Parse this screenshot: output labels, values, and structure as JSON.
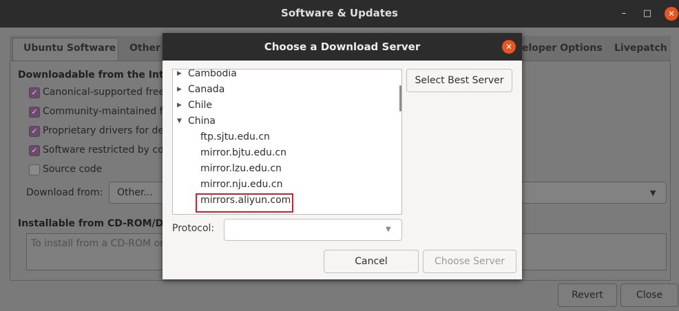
{
  "window": {
    "title": "Software & Updates"
  },
  "tabs": [
    "Ubuntu Software",
    "Other",
    "eloper Options",
    "Livepatch"
  ],
  "main": {
    "downloadable_heading": "Downloadable from the Intern",
    "checkboxes": [
      {
        "label": "Canonical-supported free",
        "checked": true
      },
      {
        "label": "Community-maintained fr",
        "checked": true
      },
      {
        "label": "Proprietary drivers for de",
        "checked": true
      },
      {
        "label": "Software restricted by cop",
        "checked": true
      },
      {
        "label": "Source code",
        "checked": false
      }
    ],
    "download_from_label": "Download from:",
    "download_from_value": "Other...",
    "cdrom_heading": "Installable from CD-ROM/DVD",
    "cdrom_text": "To install from a CD-ROM or D"
  },
  "bottom_buttons": {
    "revert": "Revert",
    "close": "Close"
  },
  "dialog": {
    "title": "Choose a Download Server",
    "tree": [
      {
        "label": "Cambodia",
        "expanded": false
      },
      {
        "label": "Canada",
        "expanded": false
      },
      {
        "label": "Chile",
        "expanded": false
      },
      {
        "label": "China",
        "expanded": true
      },
      {
        "label": "ftp.sjtu.edu.cn",
        "child": true
      },
      {
        "label": "mirror.bjtu.edu.cn",
        "child": true
      },
      {
        "label": "mirror.lzu.edu.cn",
        "child": true
      },
      {
        "label": "mirror.nju.edu.cn",
        "child": true
      },
      {
        "label": "mirrors.aliyun.com",
        "child": true
      }
    ],
    "select_best": "Select Best Server",
    "protocol_label": "Protocol:",
    "cancel": "Cancel",
    "choose": "Choose Server"
  },
  "colors": {
    "accent_close": "#e95420",
    "highlight": "#d1202d",
    "checkbox": "#6b4a6b"
  }
}
